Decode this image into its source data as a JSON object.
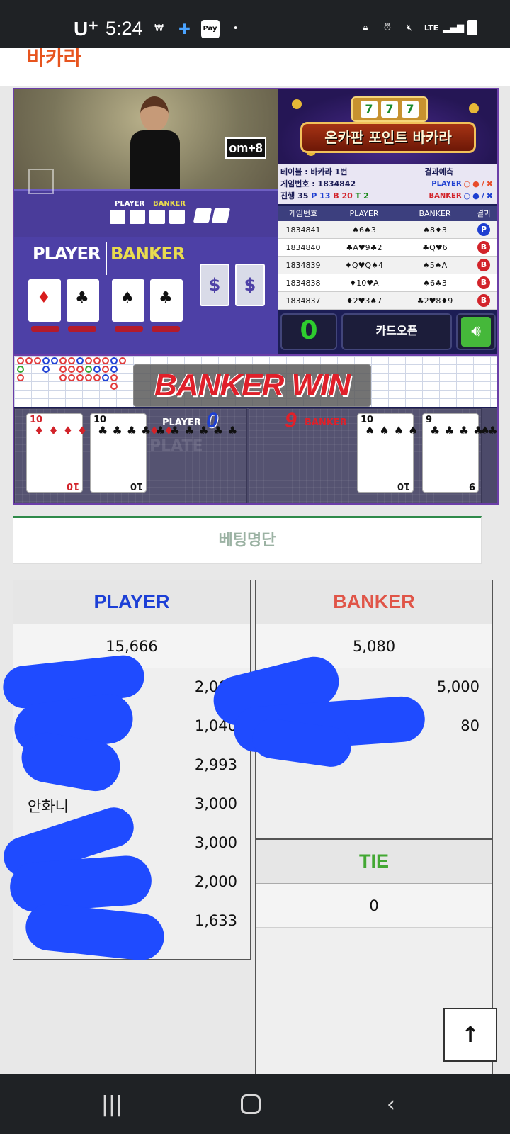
{
  "status_bar": {
    "carrier": "U⁺",
    "time": "5:24",
    "left_icons": [
      "won-icon",
      "plus-icon",
      "pay-icon",
      "dot-icon"
    ],
    "right_icons": [
      "lock-icon",
      "alarm-icon",
      "mute-icon",
      "lte-icon",
      "signal-icon",
      "battery-icon"
    ],
    "pay_label": "Pay",
    "lte_label": "LTE"
  },
  "header": {
    "title": "바카라"
  },
  "game": {
    "video_sign": "om+8",
    "table_labels": {
      "player": "PLAYER",
      "banker": "BANKER"
    },
    "overlay": {
      "player": "PLAYER",
      "banker": "BANKER"
    },
    "banner": {
      "title": "온카판 포인트 바카라",
      "slot": [
        "7",
        "7",
        "7"
      ]
    },
    "info": {
      "table": "테이블 : 바카라 1번",
      "result_label": "결과예측",
      "game_no": "게임번호 : 1834842",
      "progress_label": "진행 35",
      "p_count": "P 13",
      "b_count": "B 20",
      "t_count": "T 2",
      "pred_player": "PLAYER",
      "pred_banker": "BANKER"
    },
    "history": {
      "headers": [
        "게임번호",
        "PLAYER",
        "BANKER",
        "결과"
      ],
      "rows": [
        {
          "no": "1834841",
          "player": "♠6♠3",
          "banker": "♠8♦3",
          "result": "P"
        },
        {
          "no": "1834840",
          "player": "♣A♥9♣2",
          "banker": "♣Q♥6",
          "result": "B"
        },
        {
          "no": "1834839",
          "player": "♦Q♥Q♠4",
          "banker": "♠5♠A",
          "result": "B"
        },
        {
          "no": "1834838",
          "player": "♦10♥A",
          "banker": "♠6♣3",
          "result": "B"
        },
        {
          "no": "1834837",
          "player": "♦2♥3♠7",
          "banker": "♣2♥8♦9",
          "result": "B"
        }
      ]
    },
    "controls": {
      "count": "0",
      "card_open": "카드오픈"
    },
    "win_text": "BANKER WIN",
    "result": {
      "player_label": "PLAYER",
      "player_score": "0",
      "banker_label": "BANKER",
      "banker_score": "9",
      "plate": "PLATE",
      "player_cards": [
        {
          "rank": "10",
          "suit": "♦",
          "color": "red"
        },
        {
          "rank": "10",
          "suit": "♣",
          "color": "blk"
        }
      ],
      "banker_cards": [
        {
          "rank": "10",
          "suit": "♠",
          "color": "blk"
        },
        {
          "rank": "9",
          "suit": "♣",
          "color": "blk"
        }
      ]
    }
  },
  "betting": {
    "title": "베팅명단",
    "player": {
      "label": "PLAYER",
      "total": "15,666",
      "entries": [
        {
          "name": "",
          "amount": "2,000"
        },
        {
          "name": "",
          "amount": "1,040"
        },
        {
          "name": "",
          "amount": "2,993"
        },
        {
          "name": "안화니",
          "amount": "3,000"
        },
        {
          "name": "",
          "amount": "3,000"
        },
        {
          "name": "",
          "amount": "2,000"
        },
        {
          "name": "",
          "amount": "1,633"
        }
      ]
    },
    "banker": {
      "label": "BANKER",
      "total": "5,080",
      "entries": [
        {
          "name": "",
          "amount": "5,000"
        },
        {
          "name": "",
          "amount": "80"
        }
      ]
    },
    "tie": {
      "label": "TIE",
      "total": "0"
    }
  },
  "colors": {
    "player": "#1c3fd6",
    "banker": "#e05548",
    "tie": "#43a833",
    "header_title": "#e7541e"
  }
}
